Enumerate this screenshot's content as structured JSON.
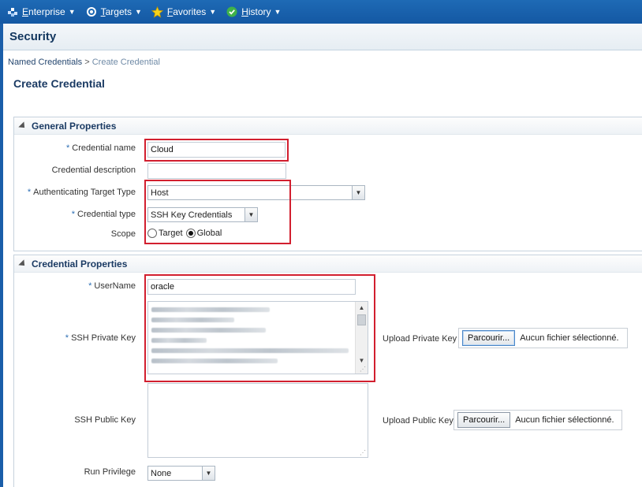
{
  "nav": {
    "items": [
      {
        "label": "Enterprise",
        "icon": "enterprise-icon"
      },
      {
        "label": "Targets",
        "icon": "targets-icon"
      },
      {
        "label": "Favorites",
        "icon": "star-icon"
      },
      {
        "label": "History",
        "icon": "history-icon"
      }
    ]
  },
  "page": {
    "title": "Security"
  },
  "breadcrumb": {
    "link": "Named Credentials",
    "separator": ">",
    "current": "Create Credential"
  },
  "form": {
    "title": "Create Credential"
  },
  "general": {
    "title": "General Properties",
    "credential_name_label": "Credential name",
    "credential_name_value": "Cloud",
    "credential_description_label": "Credential description",
    "credential_description_value": "",
    "auth_target_type_label": "Authenticating Target Type",
    "auth_target_type_value": "Host",
    "credential_type_label": "Credential type",
    "credential_type_value": "SSH Key Credentials",
    "scope_label": "Scope",
    "scope_options": [
      "Target",
      "Global"
    ],
    "scope_selected": "Global"
  },
  "credprops": {
    "title": "Credential Properties",
    "username_label": "UserName",
    "username_value": "oracle",
    "private_key_label": "SSH Private Key",
    "upload_private_label": "Upload Private Key",
    "public_key_label": "SSH Public Key",
    "upload_public_label": "Upload Public Key",
    "browse_label": "Parcourir...",
    "no_file_label": "Aucun fichier sélectionné.",
    "run_privilege_label": "Run Privilege",
    "run_privilege_value": "None"
  },
  "required_marker": "*",
  "colors": {
    "nav_bg": "#1a5ea9",
    "highlight_box": "#d21f2f",
    "title_text": "#12365e"
  }
}
